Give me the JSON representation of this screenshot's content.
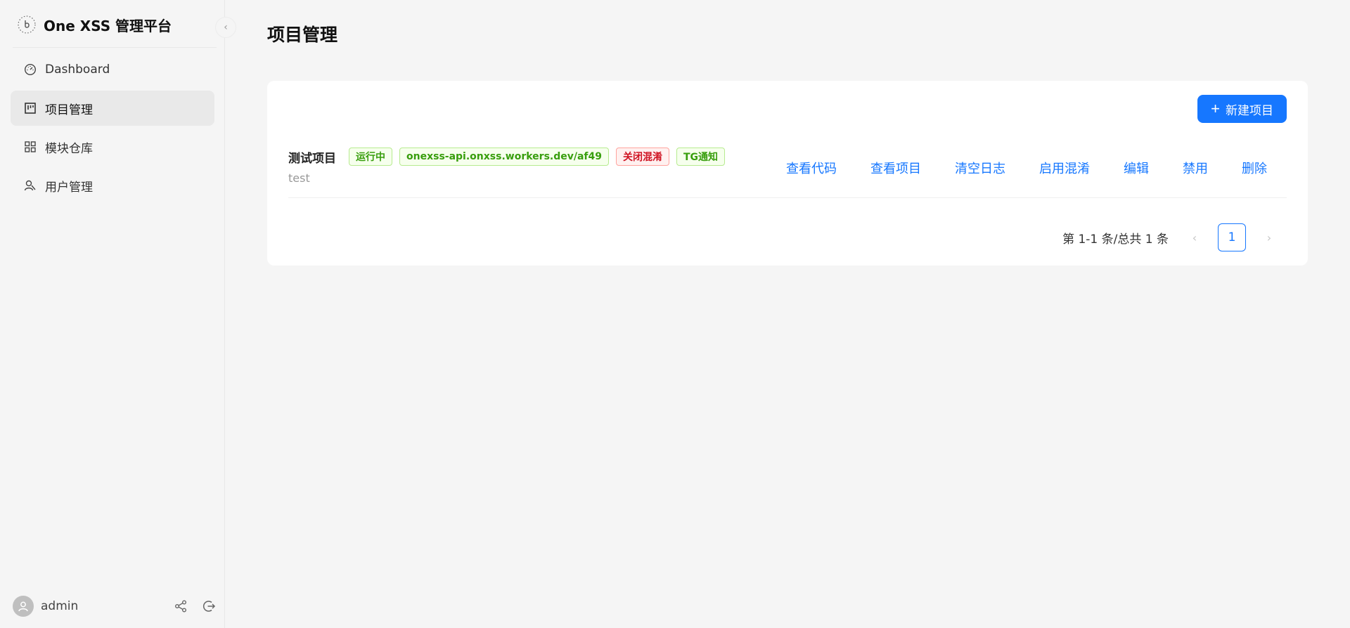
{
  "app": {
    "title": "One XSS 管理平台"
  },
  "sidebar": {
    "collapse_glyph": "‹",
    "items": [
      {
        "label": "Dashboard",
        "icon": "dashboard-icon",
        "active": false
      },
      {
        "label": "项目管理",
        "icon": "project-icon",
        "active": true
      },
      {
        "label": "模块仓库",
        "icon": "modules-icon",
        "active": false
      },
      {
        "label": "用户管理",
        "icon": "users-icon",
        "active": false
      }
    ],
    "user": {
      "name": "admin"
    }
  },
  "main": {
    "title": "项目管理",
    "new_button_label": "新建项目",
    "projects": [
      {
        "name": "测试项目",
        "description": "test",
        "tags": [
          {
            "text": "运行中",
            "color": "green"
          },
          {
            "text": "onexss-api.onxss.workers.dev/af49",
            "color": "green"
          },
          {
            "text": "关闭混淆",
            "color": "red"
          },
          {
            "text": "TG通知",
            "color": "green"
          }
        ],
        "actions": [
          "查看代码",
          "查看项目",
          "清空日志",
          "启用混淆",
          "编辑",
          "禁用",
          "删除"
        ]
      }
    ],
    "pagination": {
      "total_text": "第 1-1 条/总共 1 条",
      "current_page": "1",
      "prev_glyph": "‹",
      "next_glyph": "›"
    }
  },
  "colors": {
    "primary": "#1677ff",
    "tag_green": "#389e0d",
    "tag_red": "#cf1322"
  }
}
